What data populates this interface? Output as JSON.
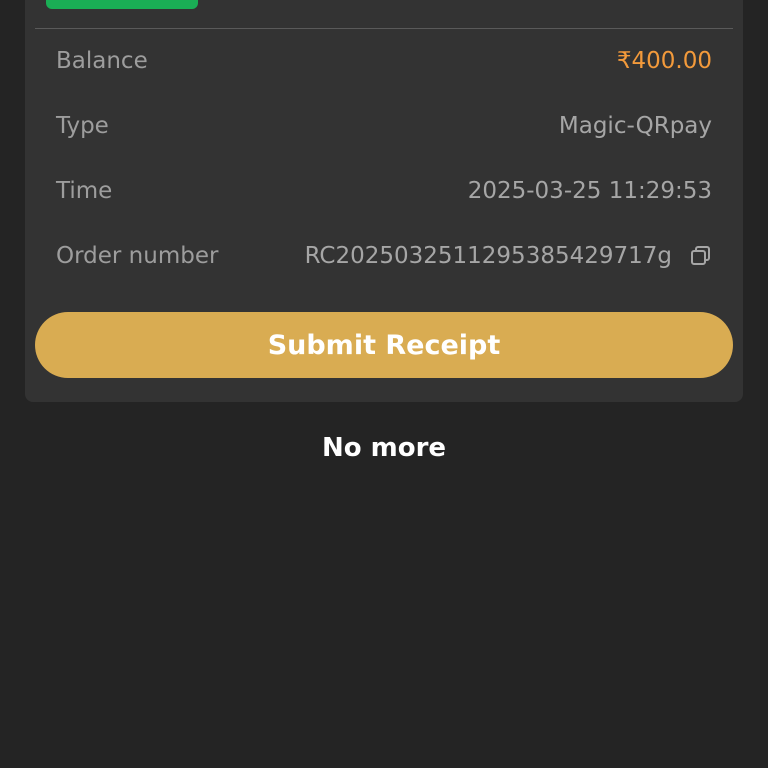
{
  "record": {
    "status_color": "#1aae55",
    "rows": [
      {
        "label": "Balance",
        "value": "₹400.00",
        "value_color": "#f39a3b"
      },
      {
        "label": "Type",
        "value": "Magic-QRpay"
      },
      {
        "label": "Time",
        "value": "2025-03-25 11:29:53"
      },
      {
        "label": "Order number",
        "value": "RC2025032511295385429717g",
        "icon": "copy-icon"
      }
    ],
    "submit_label": "Submit Receipt",
    "submit_color": "#d9ac52"
  },
  "footer": {
    "no_more_text": "No more"
  }
}
